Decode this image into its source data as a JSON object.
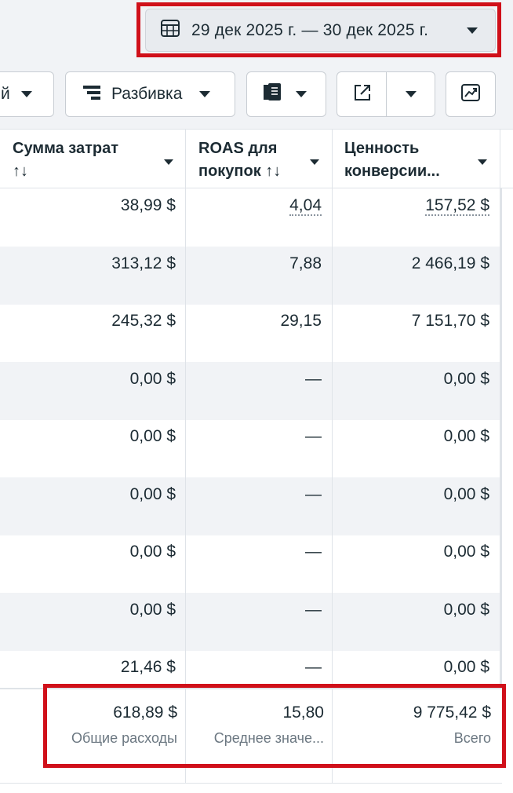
{
  "date_range": {
    "label": "29 дек 2025 г. — 30 дек 2025 г.",
    "icon": "calendar-icon"
  },
  "toolbar": {
    "partial_left_label": "й",
    "breakdown_label": "Разбивка",
    "reports_icon": "reports-icon",
    "export_icon": "export-icon",
    "chart_icon": "trend-chart-icon"
  },
  "columns": [
    {
      "line1": "Сумма затрат",
      "line2": "↑↓"
    },
    {
      "line1": "ROAS для",
      "line2": "покупок ↑↓"
    },
    {
      "line1": "Ценность",
      "line2": "конверсии..."
    }
  ],
  "rows": [
    {
      "spend": "38,99 $",
      "roas": "4,04",
      "value": "157,52 $",
      "dotted": true
    },
    {
      "spend": "313,12 $",
      "roas": "7,88",
      "value": "2 466,19 $"
    },
    {
      "spend": "245,32 $",
      "roas": "29,15",
      "value": "7 151,70 $"
    },
    {
      "spend": "0,00 $",
      "roas": "—",
      "value": "0,00 $"
    },
    {
      "spend": "0,00 $",
      "roas": "—",
      "value": "0,00 $"
    },
    {
      "spend": "0,00 $",
      "roas": "—",
      "value": "0,00 $"
    },
    {
      "spend": "0,00 $",
      "roas": "—",
      "value": "0,00 $"
    },
    {
      "spend": "0,00 $",
      "roas": "—",
      "value": "0,00 $"
    },
    {
      "spend": "21,46 $",
      "roas": "—",
      "value": "0,00 $"
    }
  ],
  "totals": {
    "spend": "618,89 $",
    "spend_label": "Общие расходы",
    "roas": "15,80",
    "roas_label": "Среднее значе...",
    "value": "9 775,42 $",
    "value_label": "Всего"
  },
  "highlight_color": "#d0101a"
}
